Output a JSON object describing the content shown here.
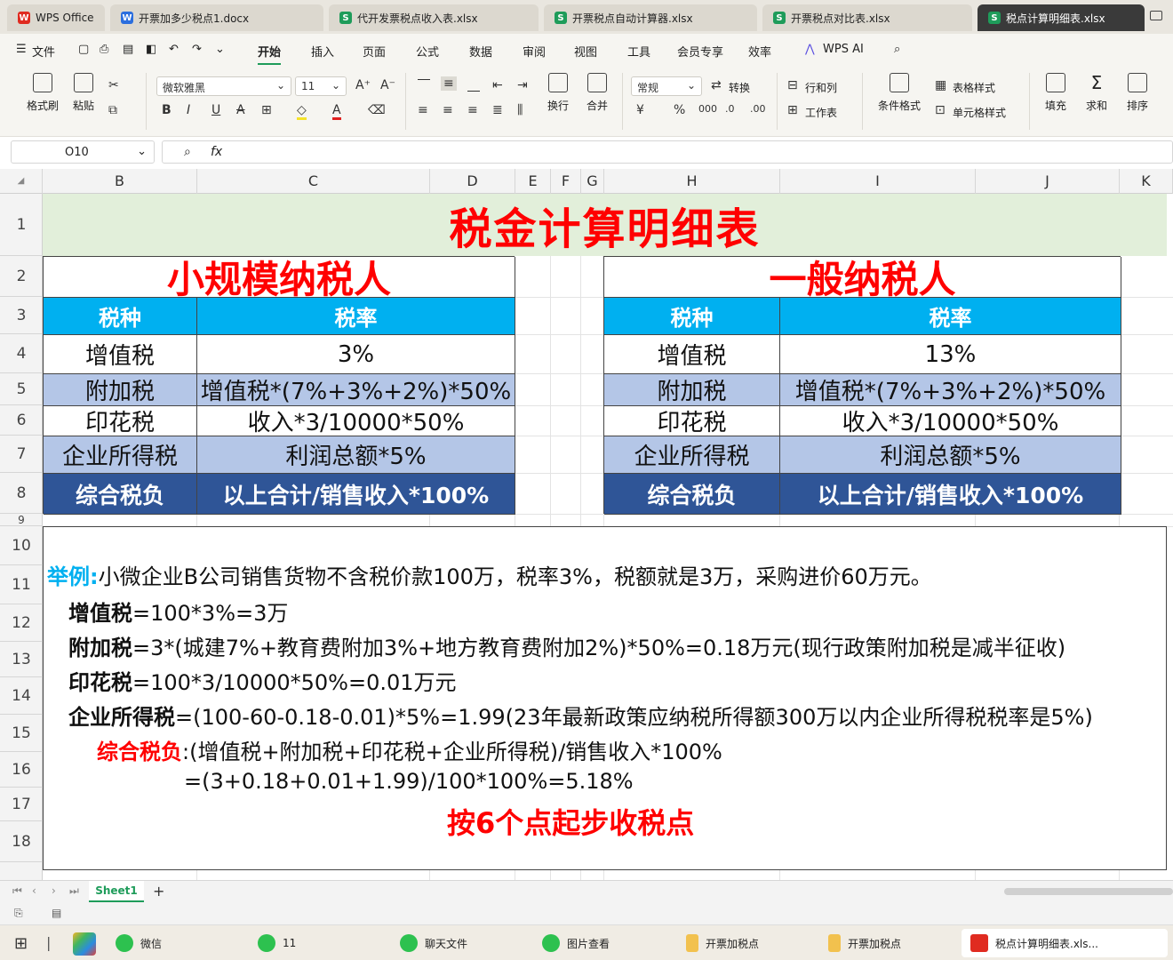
{
  "tabs": [
    {
      "label": "WPS Office",
      "icon": "wps-icon",
      "color": "#e02b20",
      "active": false
    },
    {
      "label": "开票加多少税点1.docx",
      "icon": "word-doc-icon",
      "color": "#2b6ede",
      "active": false
    },
    {
      "label": "代开发票税点收入表.xlsx",
      "icon": "sheet-icon",
      "color": "#1e9c5a",
      "active": false
    },
    {
      "label": "开票税点自动计算器.xlsx",
      "icon": "sheet-icon",
      "color": "#1e9c5a",
      "active": false
    },
    {
      "label": "开票税点对比表.xlsx",
      "icon": "sheet-icon",
      "color": "#1e9c5a",
      "active": false
    },
    {
      "label": "税点计算明细表.xlsx",
      "icon": "sheet-icon",
      "color": "#1e9c5a",
      "active": true
    }
  ],
  "menu": {
    "file": "文件",
    "items": [
      "开始",
      "插入",
      "页面",
      "公式",
      "数据",
      "审阅",
      "视图",
      "工具",
      "会员专享",
      "效率"
    ],
    "wps_ai": "WPS AI"
  },
  "toolbar": {
    "format_painter": "格式刷",
    "paste": "粘贴",
    "font_name": "微软雅黑",
    "font_size": "11",
    "wrap": "换行",
    "merge": "合并",
    "number_format": "常规",
    "convert": "转换",
    "row_col": "行和列",
    "worksheet": "工作表",
    "cond_format": "条件格式",
    "table_style": "表格样式",
    "cell_style": "单元格样式",
    "fill": "填充",
    "sum": "求和",
    "sort": "排序"
  },
  "formula_bar": {
    "cell_ref": "O10",
    "fx": "fx",
    "value": ""
  },
  "columns": [
    "B",
    "C",
    "D",
    "E",
    "F",
    "G",
    "H",
    "I",
    "J",
    "K"
  ],
  "rows": [
    "1",
    "2",
    "3",
    "4",
    "5",
    "6",
    "7",
    "8",
    "9",
    "10",
    "11",
    "12",
    "13",
    "14",
    "15",
    "16",
    "17",
    "18"
  ],
  "sheet": {
    "title": "税金计算明细表",
    "left": {
      "heading": "小规模纳税人",
      "col1": "税种",
      "col2": "税率",
      "rows": [
        {
          "type": "增值税",
          "rate": "3%"
        },
        {
          "type": "附加税",
          "rate": "增值税*(7%+3%+2%)*50%"
        },
        {
          "type": "印花税",
          "rate": "收入*3/10000*50%"
        },
        {
          "type": "企业所得税",
          "rate": "利润总额*5%"
        }
      ],
      "total_label": "综合税负",
      "total_value": "以上合计/销售收入*100%"
    },
    "right": {
      "heading": "一般纳税人",
      "col1": "税种",
      "col2": "税率",
      "rows": [
        {
          "type": "增值税",
          "rate": "13%"
        },
        {
          "type": "附加税",
          "rate": "增值税*(7%+3%+2%)*50%"
        },
        {
          "type": "印花税",
          "rate": "收入*3/10000*50%"
        },
        {
          "type": "企业所得税",
          "rate": "利润总额*5%"
        }
      ],
      "total_label": "综合税负",
      "total_value": "以上合计/销售收入*100%"
    },
    "example": {
      "label": "举例:",
      "intro": "小微企业B公司销售货物不含税价款100万，税率3%，税额就是3万，采购进价60万元。",
      "vat_label": "增值税",
      "vat_text": "=100*3%=3万",
      "surtax_label": "附加税",
      "surtax_text": "=3*(城建7%+教育费附加3%+地方教育费附加2%)*50%=0.18万元(现行政策附加税是减半征收)",
      "stamp_label": "印花税",
      "stamp_text": "=100*3/10000*50%=0.01万元",
      "cit_label": "企业所得税",
      "cit_text": "=(100-60-0.18-0.01)*5%=1.99(23年最新政策应纳税所得额300万以内企业所得税税率是5%)",
      "burden_label": "综合税负",
      "burden_text": ":(增值税+附加税+印花税+企业所得税)/销售收入*100%",
      "burden_calc": "=(3+0.18+0.01+1.99)/100*100%=5.18%",
      "conclusion": "按6个点起步收税点"
    }
  },
  "sheet_tab": "Sheet1",
  "taskbar": [
    {
      "label": "微信",
      "icon": "wechat-icon"
    },
    {
      "label": "11",
      "icon": "wechat-icon"
    },
    {
      "label": "聊天文件",
      "icon": "wechat-icon"
    },
    {
      "label": "图片查看",
      "icon": "wechat-icon"
    },
    {
      "label": "开票加税点",
      "icon": "folder-icon"
    },
    {
      "label": "开票加税点",
      "icon": "folder-icon"
    },
    {
      "label": "税点计算明细表.xls...",
      "icon": "wps-icon"
    }
  ],
  "colors": {
    "title_bg": "#e2efda",
    "header_cyan": "#00b0f0",
    "row_lavender": "#b4c6e7",
    "total_navy": "#2f5597",
    "red": "#ff0000",
    "example_blue": "#00b0f0"
  }
}
